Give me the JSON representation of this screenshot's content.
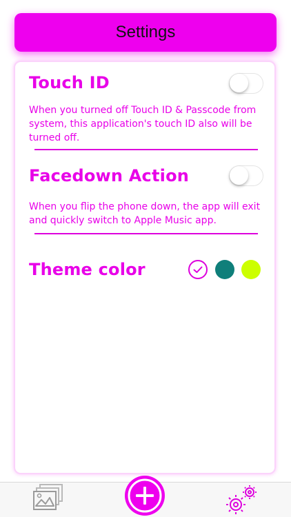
{
  "header": {
    "title": "Settings"
  },
  "touch_id": {
    "title": "Touch ID",
    "description": "When you turned off Touch ID & Passcode from system, this application's touch ID also will be turned off.",
    "enabled": false
  },
  "facedown": {
    "title": "Facedown Action",
    "description": "When you flip the phone down, the app will exit and quickly switch to Apple Music app.",
    "enabled": false
  },
  "theme": {
    "title": "Theme color",
    "options": [
      {
        "name": "magenta",
        "color": "#dd00dd",
        "selected": true
      },
      {
        "name": "teal",
        "color": "#0f7f7a",
        "selected": false
      },
      {
        "name": "lime",
        "color": "#ccff00",
        "selected": false
      }
    ]
  },
  "tabbar": {
    "items": [
      {
        "icon": "gallery-icon"
      },
      {
        "icon": "add-icon"
      },
      {
        "icon": "gears-icon"
      }
    ]
  },
  "colors": {
    "accent": "#ee00ee"
  }
}
